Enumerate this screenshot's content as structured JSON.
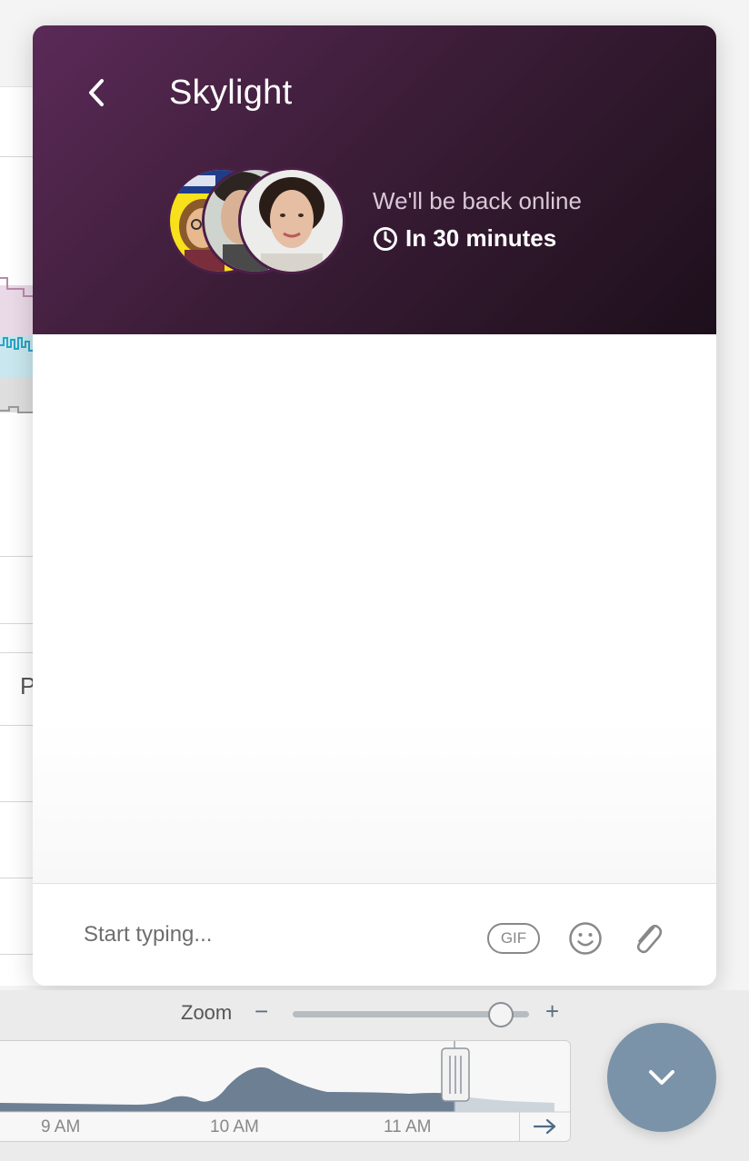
{
  "chat": {
    "title": "Skylight",
    "status": "We'll be back online",
    "eta": "In 30 minutes",
    "composer": {
      "placeholder": "Start typing...",
      "gif_label": "GIF"
    },
    "avatars": [
      "team-member-avatar",
      "team-member-avatar",
      "team-member-avatar"
    ]
  },
  "background_app": {
    "partial_text": "P",
    "timeline": {
      "zoom_label": "Zoom",
      "zoom_minus": "−",
      "zoom_plus": "+",
      "zoom_level": 0.88,
      "time_labels": [
        "9 AM",
        "10 AM",
        "11 AM"
      ]
    }
  },
  "icons": {
    "back": "chevron-left-icon",
    "clock": "clock-icon",
    "emoji": "smiley-icon",
    "attach": "paperclip-icon",
    "launcher": "chevron-down-icon",
    "timeline_next": "arrow-right-icon"
  },
  "colors": {
    "header_start": "#5b2a58",
    "header_end": "#1d0f1b",
    "launcher": "#7b93a8",
    "timeline_fill": "#6d7f93"
  }
}
